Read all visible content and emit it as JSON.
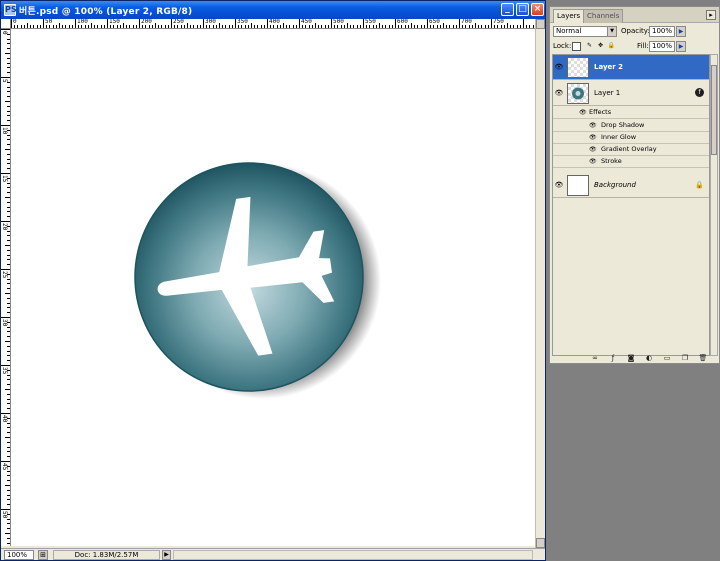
{
  "window": {
    "app_icon": "PS",
    "title": "버튼.psd @ 100% (Layer 2, RGB/8)",
    "buttons": {
      "minimize": "_",
      "maximize": "□",
      "close": "×"
    }
  },
  "ruler": {
    "top_labels": [
      "0",
      "50",
      "100",
      "150",
      "200",
      "250",
      "300",
      "350",
      "400",
      "450",
      "500",
      "550",
      "600",
      "650",
      "700",
      "750"
    ],
    "left_labels": [
      "0",
      "5",
      "10",
      "15",
      "20",
      "25",
      "30",
      "35",
      "40",
      "45",
      "50"
    ]
  },
  "status": {
    "zoom": "100%",
    "doc": "Doc: 1.83M/2.57M",
    "arrow": "▶",
    "nav_icon": "⊞"
  },
  "layers_panel": {
    "tabs": [
      "Layers",
      "Channels"
    ],
    "menu": "▸",
    "blend_mode": "Normal",
    "opacity_label": "Opacity:",
    "opacity_value": "100%",
    "lock_label": "Lock:",
    "fill_label": "Fill:",
    "fill_value": "100%",
    "layers": [
      {
        "name": "Layer 2",
        "selected": true
      },
      {
        "name": "Layer 1",
        "selected": false,
        "fx": "f"
      },
      {
        "name": "Background",
        "selected": false,
        "locked": "🔒"
      }
    ],
    "effects_label": "Effects",
    "effects": [
      "Drop Shadow",
      "Inner Glow",
      "Gradient Overlay",
      "Stroke"
    ],
    "eye": "👁"
  },
  "colors": {
    "selection": "#316ac5",
    "button_dark": "#1e5864",
    "button_light": "#b8d4da",
    "titlebar": "#0450d8"
  }
}
